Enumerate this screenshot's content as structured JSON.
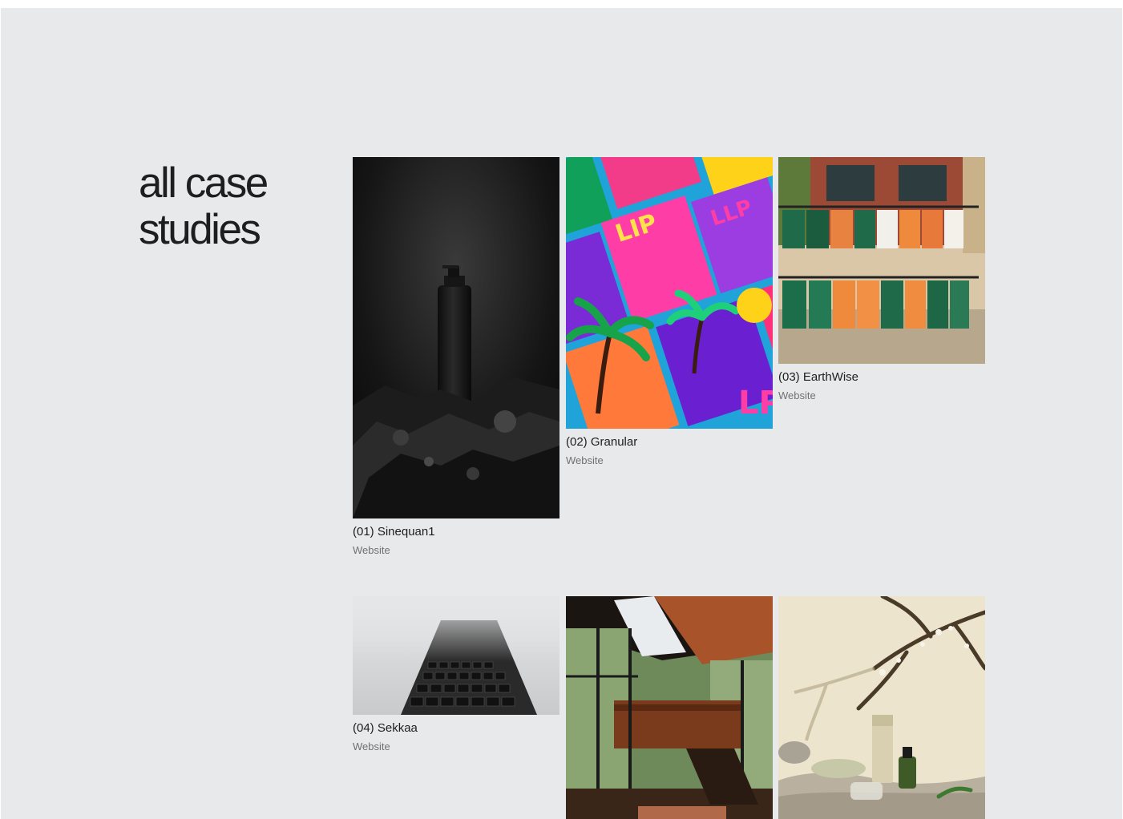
{
  "page": {
    "title_line1": "all case",
    "title_line2": "studies"
  },
  "colors": {
    "background": "#e8e9eb",
    "text": "#1e1e1e",
    "muted": "#6f7175"
  },
  "case_studies": [
    {
      "title": "(01) Sinequan1",
      "category": "Website",
      "image": "black-bottle-on-rocks"
    },
    {
      "title": "(02) Granular",
      "category": "Website",
      "image": "colorful-packaging-palm-trees"
    },
    {
      "title": "(03) EarthWise",
      "category": "Website",
      "image": "clothing-rack-storefront"
    },
    {
      "title": "(04) Sekkaa",
      "category": "Website",
      "image": "keyboard-in-fog"
    },
    {
      "title": "",
      "category": "",
      "image": "modern-house-interior"
    },
    {
      "title": "",
      "category": "",
      "image": "cosmetic-bottles-under-branches"
    }
  ]
}
